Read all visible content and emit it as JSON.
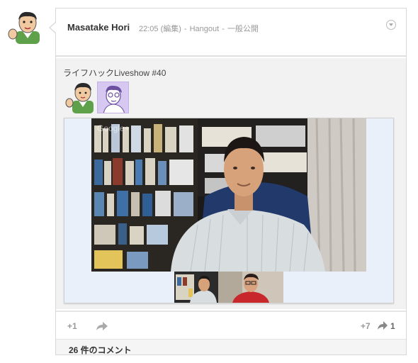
{
  "post": {
    "author": "Masatake Hori",
    "time": "22:05",
    "edited": "(編集)",
    "source": "Hangout",
    "visibility": "一般公開",
    "separator": "-"
  },
  "share": {
    "title": "ライフハックLiveshow #40",
    "video_watermark": "Google+"
  },
  "actions": {
    "plusone_label": "+1",
    "plusone_count": "+7",
    "share_count": "1"
  },
  "comments": {
    "count_label": "26 件のコメント"
  },
  "colors": {
    "accent_green": "#5fa04a",
    "participant_bg": "#d6c8f0",
    "video_bg": "#1b1a18"
  },
  "icons": [
    "author-avatar",
    "menu-chevron-icon",
    "share-arrow-icon",
    "participant-avatar"
  ]
}
